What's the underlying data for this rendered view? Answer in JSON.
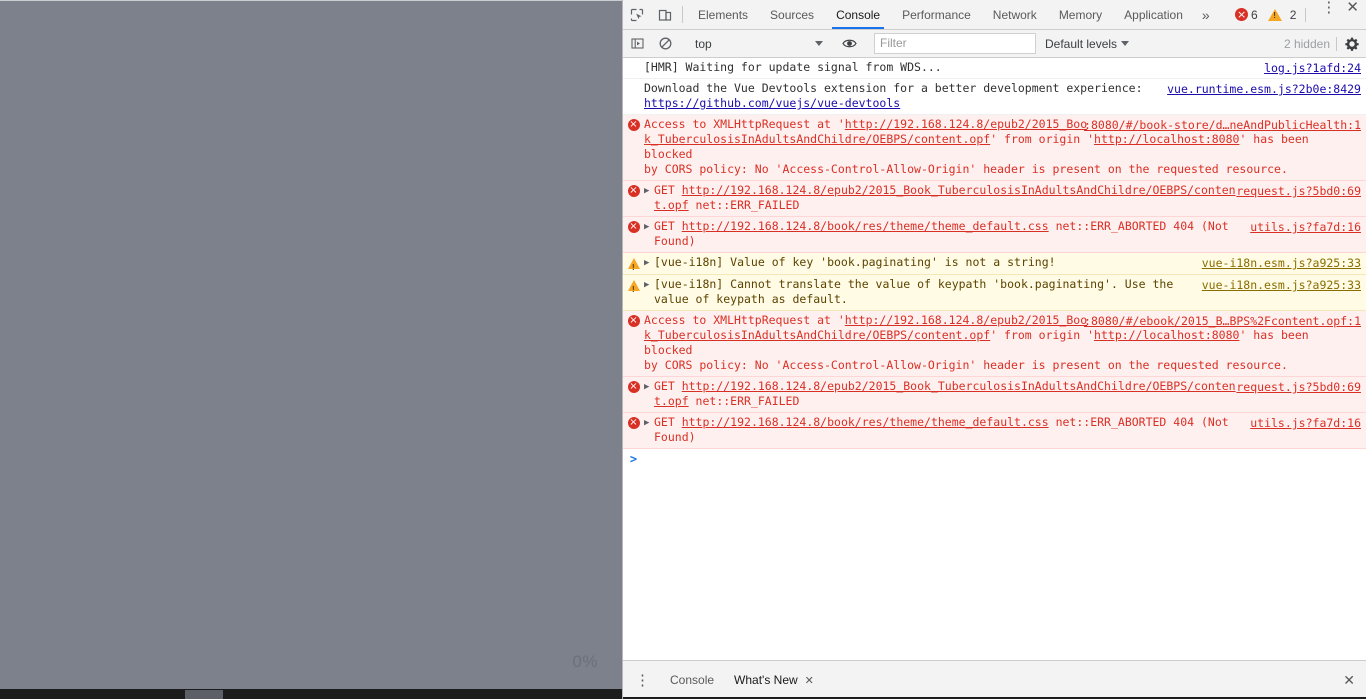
{
  "page": {
    "progress_label": "0%",
    "background_color": "#7d818b"
  },
  "devtools": {
    "toolbar": {
      "inspect_icon": "inspect-element-icon",
      "device_toolbar_icon": "device-toolbar-icon",
      "tabs": [
        {
          "label": "Elements",
          "selected": false
        },
        {
          "label": "Sources",
          "selected": false
        },
        {
          "label": "Console",
          "selected": true
        },
        {
          "label": "Performance",
          "selected": false
        },
        {
          "label": "Network",
          "selected": false
        },
        {
          "label": "Memory",
          "selected": false
        },
        {
          "label": "Application",
          "selected": false
        }
      ],
      "more_tabs_label": "»",
      "error_count": "6",
      "warning_count": "2",
      "main_menu_icon": "kebab-menu-icon",
      "close_icon": "close-icon"
    },
    "filterbar": {
      "execute_icon": "console-sidebar-icon",
      "clear_icon": "clear-console-icon",
      "context_value": "top",
      "eye_icon": "live-expression-icon",
      "filter_placeholder": "Filter",
      "filter_value": "",
      "levels_value": "Default levels",
      "hidden_label": "2 hidden",
      "settings_icon": "gear-icon"
    },
    "messages": [
      {
        "level": "plain",
        "icon": "",
        "expandable": false,
        "lines": [
          [
            {
              "t": "[HMR] Waiting for update signal from WDS...",
              "link": false
            }
          ]
        ],
        "source": "log.js?1afd:24"
      },
      {
        "level": "plain",
        "icon": "",
        "expandable": false,
        "lines": [
          [
            {
              "t": "Download the Vue Devtools extension for a better development experience:",
              "link": false
            }
          ],
          [
            {
              "t": "https://github.com/vuejs/vue-devtools",
              "link": true
            }
          ]
        ],
        "source": "vue.runtime.esm.js?2b0e:8429"
      },
      {
        "level": "error",
        "icon": "error-icon",
        "expandable": false,
        "lines": [
          [
            {
              "t": "Access to XMLHttpRequest at '",
              "link": false
            },
            {
              "t": "http://192.168.124.8/epub2/2015_Boo",
              "link": true
            }
          ],
          [
            {
              "t": "k_TuberculosisInAdultsAndChildre/OEBPS/content.opf",
              "link": true
            },
            {
              "t": "' from origin '",
              "link": false
            },
            {
              "t": "http://localhost:8080",
              "link": true
            },
            {
              "t": "' has been blocked",
              "link": false
            }
          ],
          [
            {
              "t": "by CORS policy: No 'Access-Control-Allow-Origin' header is present on the requested resource.",
              "link": false
            }
          ]
        ],
        "source": ":8080/#/book-store/d…neAndPublicHealth:1"
      },
      {
        "level": "error",
        "icon": "error-icon",
        "expandable": true,
        "lines": [
          [
            {
              "t": "GET ",
              "link": false
            },
            {
              "t": "http://192.168.124.8/epub2/2015_Book_TuberculosisInAdultsAndChildre/OEBPS/conten",
              "link": true
            }
          ],
          [
            {
              "t": "t.opf",
              "link": true
            },
            {
              "t": " net::ERR_FAILED",
              "link": false
            }
          ]
        ],
        "source": "request.js?5bd0:69"
      },
      {
        "level": "error",
        "icon": "error-icon",
        "expandable": true,
        "lines": [
          [
            {
              "t": "GET ",
              "link": false
            },
            {
              "t": "http://192.168.124.8/book/res/theme/theme_default.css",
              "link": true
            },
            {
              "t": " net::ERR_ABORTED 404 (Not",
              "link": false
            }
          ],
          [
            {
              "t": "Found)",
              "link": false
            }
          ]
        ],
        "source": "utils.js?fa7d:16"
      },
      {
        "level": "warning",
        "icon": "warning-icon",
        "expandable": true,
        "lines": [
          [
            {
              "t": "[vue-i18n] Value of key 'book.paginating' is not a string!",
              "link": false
            }
          ]
        ],
        "source": "vue-i18n.esm.js?a925:33"
      },
      {
        "level": "warning",
        "icon": "warning-icon",
        "expandable": true,
        "lines": [
          [
            {
              "t": "[vue-i18n] Cannot translate the value of keypath 'book.paginating'. Use the",
              "link": false
            }
          ],
          [
            {
              "t": "value of keypath as default.",
              "link": false
            }
          ]
        ],
        "source": "vue-i18n.esm.js?a925:33"
      },
      {
        "level": "error",
        "icon": "error-icon",
        "expandable": false,
        "lines": [
          [
            {
              "t": "Access to XMLHttpRequest at '",
              "link": false
            },
            {
              "t": "http://192.168.124.8/epub2/2015_Boo",
              "link": true
            }
          ],
          [
            {
              "t": "k_TuberculosisInAdultsAndChildre/OEBPS/content.opf",
              "link": true
            },
            {
              "t": "' from origin '",
              "link": false
            },
            {
              "t": "http://localhost:8080",
              "link": true
            },
            {
              "t": "' has been blocked",
              "link": false
            }
          ],
          [
            {
              "t": "by CORS policy: No 'Access-Control-Allow-Origin' header is present on the requested resource.",
              "link": false
            }
          ]
        ],
        "source": ":8080/#/ebook/2015_B…BPS%2Fcontent.opf:1"
      },
      {
        "level": "error",
        "icon": "error-icon",
        "expandable": true,
        "lines": [
          [
            {
              "t": "GET ",
              "link": false
            },
            {
              "t": "http://192.168.124.8/epub2/2015_Book_TuberculosisInAdultsAndChildre/OEBPS/conten",
              "link": true
            }
          ],
          [
            {
              "t": "t.opf",
              "link": true
            },
            {
              "t": " net::ERR_FAILED",
              "link": false
            }
          ]
        ],
        "source": "request.js?5bd0:69"
      },
      {
        "level": "error",
        "icon": "error-icon",
        "expandable": true,
        "lines": [
          [
            {
              "t": "GET ",
              "link": false
            },
            {
              "t": "http://192.168.124.8/book/res/theme/theme_default.css",
              "link": true
            },
            {
              "t": " net::ERR_ABORTED 404 (Not",
              "link": false
            }
          ],
          [
            {
              "t": "Found)",
              "link": false
            }
          ]
        ],
        "source": "utils.js?fa7d:16"
      }
    ],
    "prompt": {
      "arrow": ">",
      "value": ""
    },
    "drawer": {
      "menu_icon": "kebab-menu-icon",
      "tabs": [
        {
          "label": "Console",
          "selected": false,
          "closable": false
        },
        {
          "label": "What's New",
          "selected": true,
          "closable": true
        }
      ],
      "close_icon": "close-icon"
    }
  },
  "colors": {
    "accent": "#1a73e8",
    "error": "#d93025",
    "warning": "#f5a623",
    "error_bg": "#fff0f0",
    "warning_bg": "#fffbe5",
    "toolbar_bg": "#f3f3f3"
  }
}
